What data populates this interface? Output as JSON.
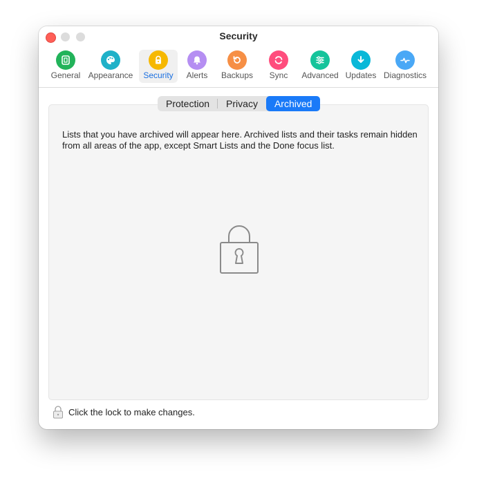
{
  "window": {
    "title": "Security"
  },
  "toolbar": {
    "items": [
      {
        "label": "General",
        "icon": "general-icon",
        "color": "#22b35a"
      },
      {
        "label": "Appearance",
        "icon": "palette-icon",
        "color": "#1fb1c8"
      },
      {
        "label": "Security",
        "icon": "lock-icon",
        "color": "#f6b800",
        "active": true
      },
      {
        "label": "Alerts",
        "icon": "bell-icon",
        "color": "#b58ef2"
      },
      {
        "label": "Backups",
        "icon": "backup-icon",
        "color": "#f68f45"
      },
      {
        "label": "Sync",
        "icon": "sync-icon",
        "color": "#ff4d7d"
      },
      {
        "label": "Advanced",
        "icon": "sliders-icon",
        "color": "#16c49b"
      },
      {
        "label": "Updates",
        "icon": "download-icon",
        "color": "#0ab8d8"
      },
      {
        "label": "Diagnostics",
        "icon": "diagnostics-icon",
        "color": "#4aa8f6"
      }
    ]
  },
  "tabs": {
    "protection": "Protection",
    "privacy": "Privacy",
    "archived": "Archived",
    "selected": "Archived"
  },
  "content": {
    "description": "Lists that you have archived will appear here. Archived lists and their tasks remain hidden from all areas of the app, except Smart Lists and the Done focus list."
  },
  "footer": {
    "lock_text": "Click the lock to make changes."
  },
  "colors": {
    "accent": "#1a7af8",
    "close": "#ff5f57"
  }
}
